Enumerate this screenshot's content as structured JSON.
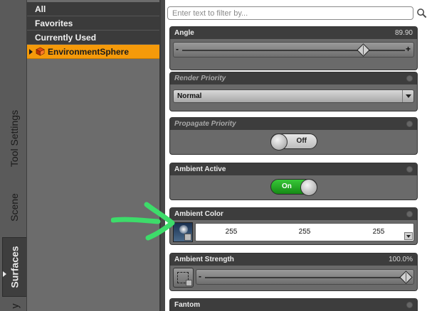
{
  "tabs": {
    "tool_settings": "Tool Settings",
    "scene": "Scene",
    "surfaces": "Surfaces",
    "more": "y"
  },
  "list": {
    "items": [
      "All",
      "Favorites",
      "Currently Used"
    ],
    "selected": "EnvironmentSphere"
  },
  "filter": {
    "placeholder": "Enter text to filter by...",
    "value": ""
  },
  "properties": {
    "angle": {
      "title": "Angle",
      "value": "89.90",
      "fraction": 0.81,
      "minus": "-",
      "plus": "+"
    },
    "render_priority": {
      "title": "Render Priority",
      "value": "Normal"
    },
    "propagate_priority": {
      "title": "Propagate Priority",
      "state": "Off"
    },
    "ambient_active": {
      "title": "Ambient Active",
      "state": "On"
    },
    "ambient_color": {
      "title": "Ambient Color",
      "r": "255",
      "g": "255",
      "b": "255"
    },
    "ambient_strength": {
      "title": "Ambient Strength",
      "value": "100.0%",
      "fraction": 1.0,
      "minus": "-"
    },
    "fantom": {
      "title": "Fantom"
    }
  },
  "colors": {
    "selection": "#f59a0a",
    "toggle_on": "#22aa22",
    "annotation_arrow": "#3ddc6a"
  }
}
